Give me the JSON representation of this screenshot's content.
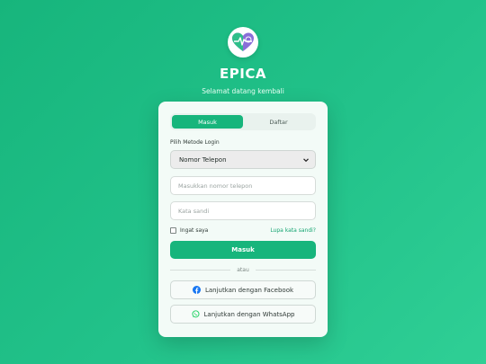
{
  "app": {
    "title": "EPICA",
    "subtitle": "Selamat datang kembali"
  },
  "tabs": [
    {
      "label": "Masuk",
      "active": true
    },
    {
      "label": "Daftar",
      "active": false
    }
  ],
  "login_method": {
    "label": "Pilih Metode Login",
    "selected": "Nomor Telepon"
  },
  "fields": {
    "phone_placeholder": "Masukkan nomor telepon",
    "password_placeholder": "Kata sandi"
  },
  "remember_label": "Ingat saya",
  "forgot_label": "Lupa kata sandi?",
  "submit_label": "Masuk",
  "divider_label": "atau",
  "social": {
    "facebook_label": "Lanjutkan dengan Facebook",
    "whatsapp_label": "Lanjutkan dengan WhatsApp"
  },
  "colors": {
    "accent": "#17b57c",
    "logo_purple": "#8a6fd8",
    "facebook": "#1877f2",
    "whatsapp": "#25d366"
  },
  "icons": [
    "heart-pulse-logo-icon",
    "chevron-down-icon",
    "facebook-icon",
    "whatsapp-icon"
  ]
}
